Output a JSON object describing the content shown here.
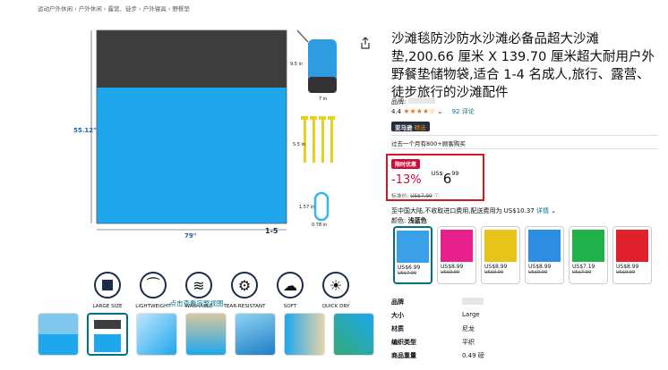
{
  "breadcrumb": "运动户外休闲 › 户外休闲 › 露营、徒步 › 户外寝具 › 野餐垫",
  "hero": {
    "dim_height": "55.12\"",
    "dim_width": "79\"",
    "dim_bag": "9.5 in",
    "dim_bag_w": "7 in",
    "dim_stake": "5.5 in",
    "dim_carab": "1.57 in",
    "dim_carab_w": "0.78 in",
    "persons": "1-5",
    "features": [
      "LARGE SIZE",
      "LIGHTWEIGHT",
      "WASHABLE",
      "TEAR-RESISTANT",
      "SOFT",
      "QUICK DRY"
    ]
  },
  "view_full": "点击查看完整视图",
  "product": {
    "title": "沙滩毯防沙防水沙滩必备品超大沙滩垫,200.66 厘米 X 139.70 厘米超大耐用户外野餐垫储物袋,适合 1-4 名成人,旅行、露营、徒步旅行的沙滩配件",
    "brand_label": "品牌:",
    "rating": "4.4",
    "stars": "★★★★☆",
    "reviews": "92 评论",
    "badge_brand": "亚马逊",
    "badge_choice": "精选",
    "sold": "过去一个月有800+顾客购买",
    "deal": "限时优惠",
    "discount": "-13%",
    "currency": "US$",
    "price_whole": "6",
    "price_frac": "99",
    "list_label": "标准价:",
    "list_price": "US$7.99",
    "shipping": "至中国大陆,不收取进口费用,配送费用为 US$10.37",
    "details": "详情",
    "color_label": "颜色:",
    "color_value": "浅蓝色"
  },
  "options": [
    {
      "price": "US$6.99",
      "strike": "US$7.99",
      "color": "#3aa0e8"
    },
    {
      "price": "US$8.99",
      "strike": "US$9.99",
      "color": "#e8208c"
    },
    {
      "price": "US$8.99",
      "strike": "US$9.99",
      "color": "#e6c41a"
    },
    {
      "price": "US$8.99",
      "strike": "US$9.99",
      "color": "#2d8de0"
    },
    {
      "price": "US$7.19",
      "strike": "US$7.99",
      "color": "#22b04a"
    },
    {
      "price": "US$8.99",
      "strike": "US$9.99",
      "color": "#e0202a"
    }
  ],
  "specs": [
    {
      "k": "品牌",
      "v": ""
    },
    {
      "k": "大小",
      "v": "Large"
    },
    {
      "k": "材质",
      "v": "尼龙"
    },
    {
      "k": "编织类型",
      "v": "平织"
    },
    {
      "k": "商品重量",
      "v": "0.49 磅"
    }
  ],
  "colors": {
    "accent": "#007185",
    "deal": "#cc0c39",
    "mat_top": "#3d3d3d",
    "mat_bottom": "#1ea7ec"
  }
}
